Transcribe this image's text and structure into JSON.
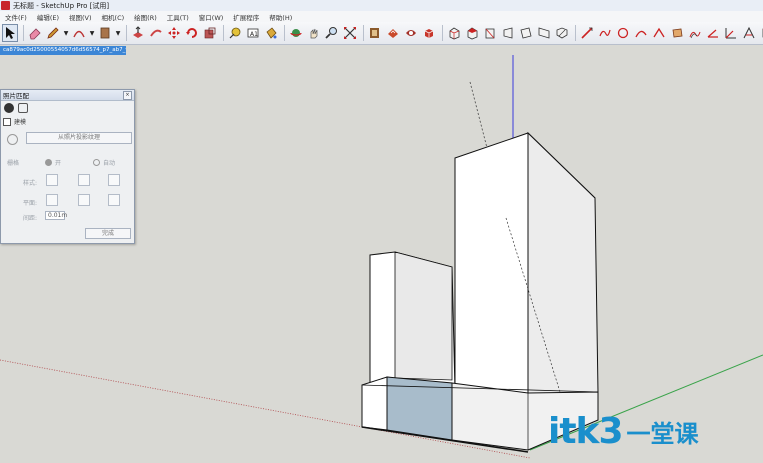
{
  "window": {
    "title": "无标题 - SketchUp Pro [试用]"
  },
  "menu": {
    "items": [
      "文件(F)",
      "编辑(E)",
      "视图(V)",
      "相机(C)",
      "绘图(R)",
      "工具(T)",
      "窗口(W)",
      "扩展程序",
      "帮助(H)"
    ]
  },
  "toolbar": {
    "icons": [
      "select-icon",
      "eraser-icon",
      "pencil-icon",
      "arc-icon",
      "rectangle-icon",
      "push-pull-icon",
      "follow-me-icon",
      "move-icon",
      "rotate-icon",
      "scale-icon",
      "tape-measure-icon",
      "text-icon",
      "paint-bucket-icon",
      "orbit-icon",
      "pan-icon",
      "zoom-icon",
      "zoom-extents-icon",
      "components-icon",
      "materials-icon",
      "styles-icon",
      "box-view-icon"
    ]
  },
  "scene": {
    "tab_label": "ca879ac0d25000554057d6d56574_p7_ab7_ws47"
  },
  "panel": {
    "title": "照片匹配",
    "checkbox_label": "建模",
    "project_button": "从照片投影纹理",
    "grid_label": "栅格",
    "radio_on": "开",
    "radio_auto": "自动",
    "style_label": "样式:",
    "plane_label": "平面:",
    "spacing_label": "间距:",
    "spacing_value": "0.01m",
    "done_button": "完成"
  },
  "watermark": {
    "latin": "itk3",
    "cn": "一堂课"
  },
  "colors": {
    "background": "#d9d9d4",
    "accent": "#3c86d6",
    "watermark": "#1a8fcc"
  }
}
